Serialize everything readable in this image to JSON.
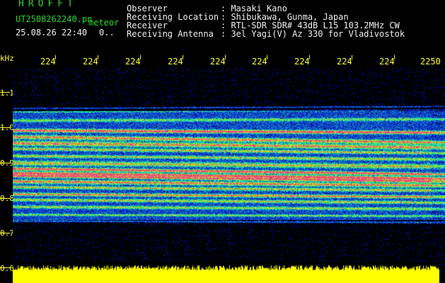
{
  "app": {
    "logo": "HROFFT",
    "filename": "UT2508262240.pn",
    "meteor_label": "meteor",
    "datetime": "25.08.26 22:40",
    "meteor_count": "0.."
  },
  "header": {
    "rows": [
      {
        "label": "Observer",
        "value": ": Masaki Kano"
      },
      {
        "label": "Receiving Location",
        "value": ": Shibukawa, Gunma, Japan"
      },
      {
        "label": "Receiver",
        "value": ": RTL-SDR SDR# 43dB L15 103.2MHz CW"
      },
      {
        "label": "Receiving Antenna",
        "value": ": 3el Yagi(V) Az 330 for Vladivostok"
      }
    ]
  },
  "time_axis": {
    "ticks": [
      "224",
      "224",
      "224",
      "224",
      "224",
      "224",
      "224",
      "224",
      "224",
      "2250"
    ]
  },
  "freq_axis": {
    "unit": "kHz",
    "labels": [
      "1.1",
      "1.0",
      "0.9",
      "0.8",
      "0.7",
      "0.6"
    ]
  },
  "colors": {
    "text_green": "#2bd92b",
    "text_white": "#f0f0f0",
    "axis_yellow": "#ffff33",
    "background": "#000000"
  }
}
